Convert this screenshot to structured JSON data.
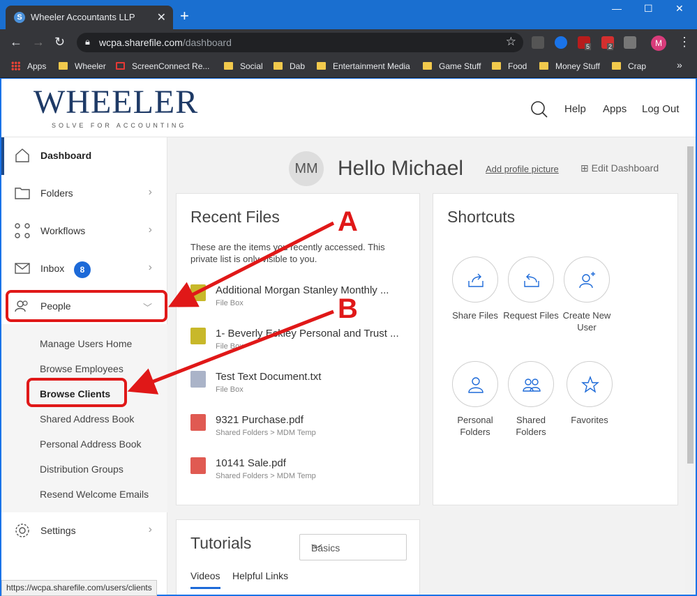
{
  "browser": {
    "tab_title": "Wheeler Accountants LLP",
    "url_host": "wcpa.sharefile.com",
    "url_path": "/dashboard",
    "profile_initial": "M",
    "extension_badges": [
      "5",
      "2"
    ],
    "bookmarks": [
      "Apps",
      "Wheeler",
      "ScreenConnect Re...",
      "Social",
      "Dab",
      "Entertainment Media",
      "Game Stuff",
      "Food",
      "Money Stuff",
      "Crap"
    ],
    "status_url": "https://wcpa.sharefile.com/users/clients"
  },
  "header": {
    "logo": "WHEELER",
    "logo_tagline": "SOLVE FOR ACCOUNTING",
    "links": [
      "Help",
      "Apps",
      "Log Out"
    ]
  },
  "sidebar": {
    "items": [
      {
        "label": "Dashboard",
        "icon": "home-icon"
      },
      {
        "label": "Folders",
        "icon": "folder-icon"
      },
      {
        "label": "Workflows",
        "icon": "workflow-icon"
      },
      {
        "label": "Inbox",
        "icon": "mail-icon",
        "badge": "8"
      },
      {
        "label": "People",
        "icon": "people-icon"
      },
      {
        "label": "Settings",
        "icon": "gear-icon"
      }
    ],
    "people_sub": [
      "Manage Users Home",
      "Browse Employees",
      "Browse Clients",
      "Shared Address Book",
      "Personal Address Book",
      "Distribution Groups",
      "Resend Welcome Emails"
    ]
  },
  "greeting": {
    "initials": "MM",
    "hello": "Hello Michael",
    "add_picture": "Add profile picture",
    "edit_dashboard": "Edit Dashboard"
  },
  "recent": {
    "title": "Recent Files",
    "description": "These are the items you recently accessed. This private list is only visible to you.",
    "files": [
      {
        "name": "Additional Morgan Stanley Monthly ...",
        "location": "File Box",
        "type": "zip"
      },
      {
        "name": "1- Beverly Eckley Personal and Trust ...",
        "location": "File Box",
        "type": "zip"
      },
      {
        "name": "Test Text Document.txt",
        "location": "File Box",
        "type": "txt"
      },
      {
        "name": "9321 Purchase.pdf",
        "location": "Shared Folders > MDM Temp",
        "type": "pdf"
      },
      {
        "name": "10141 Sale.pdf",
        "location": "Shared Folders > MDM Temp",
        "type": "pdf"
      }
    ]
  },
  "shortcuts": {
    "title": "Shortcuts",
    "items": [
      {
        "label": "Share Files",
        "icon": "share-files-icon"
      },
      {
        "label": "Request Files",
        "icon": "request-files-icon"
      },
      {
        "label": "Create New User",
        "icon": "create-user-icon"
      },
      {
        "label": "Personal Folders",
        "icon": "personal-folders-icon"
      },
      {
        "label": "Shared Folders",
        "icon": "shared-folders-icon"
      },
      {
        "label": "Favorites",
        "icon": "star-icon"
      }
    ]
  },
  "tutorials": {
    "title": "Tutorials",
    "select_value": "Basics",
    "tabs": [
      "Videos",
      "Helpful Links"
    ]
  },
  "annotations": {
    "a": "A",
    "b": "B",
    "color": "#e01818"
  }
}
